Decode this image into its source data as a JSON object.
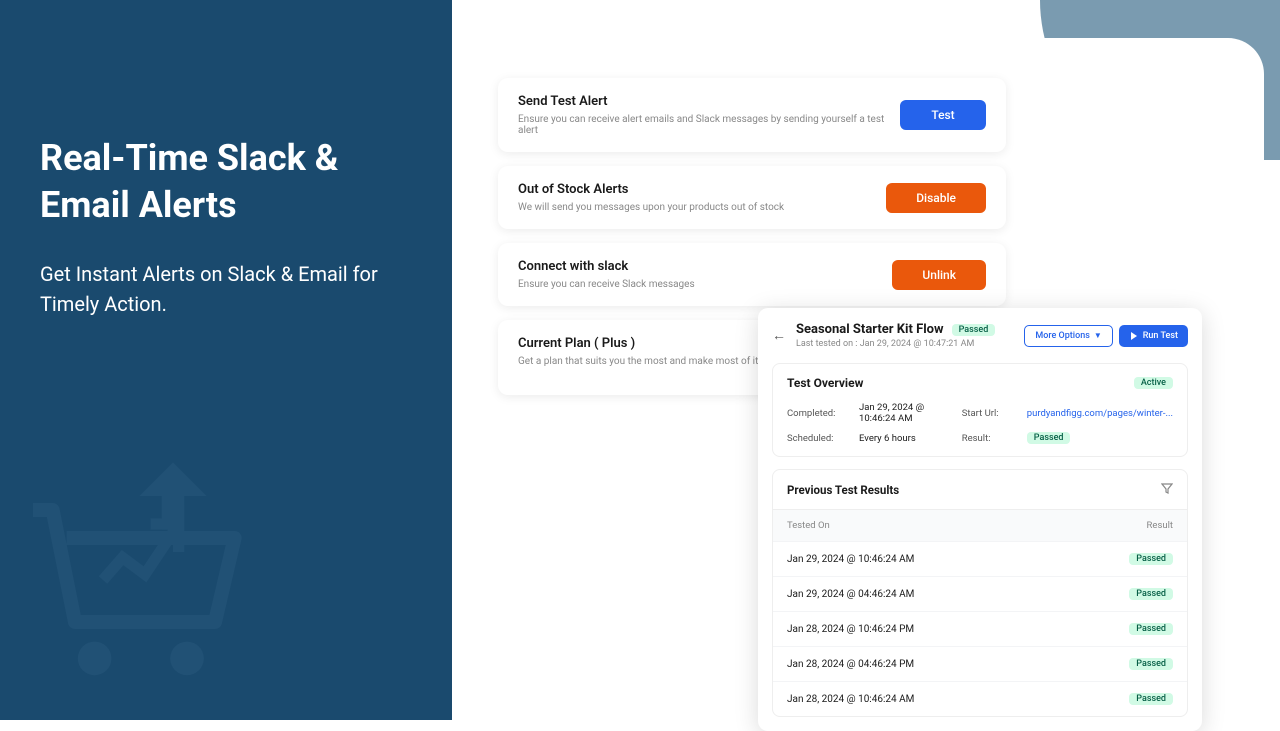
{
  "hero": {
    "title": "Real-Time Slack & Email Alerts",
    "subtitle": "Get Instant Alerts on Slack & Email for Timely Action."
  },
  "settings": [
    {
      "title": "Send Test Alert",
      "desc": "Ensure you can receive alert emails and Slack messages by sending yourself a test alert",
      "button": "Test",
      "btnClass": "btn-blue"
    },
    {
      "title": "Out of Stock Alerts",
      "desc": "We will send you messages upon your products out of stock",
      "button": "Disable",
      "btnClass": "btn-orange"
    },
    {
      "title": "Connect with slack",
      "desc": "Ensure you can receive Slack messages",
      "button": "Unlink",
      "btnClass": "btn-orange"
    },
    {
      "title": "Current Plan ( Plus )",
      "desc": "Get a plan that suits you the most and make most of it",
      "button": "",
      "btnClass": ""
    }
  ],
  "flow": {
    "title": "Seasonal Starter Kit Flow",
    "titleBadge": "Passed",
    "lastTested": "Last tested on : Jan 29, 2024 @ 10:47:21 AM",
    "moreOptions": "More Options",
    "runTest": "Run Test",
    "overview": {
      "title": "Test Overview",
      "statusBadge": "Active",
      "completed": {
        "label": "Completed:",
        "value": "Jan 29, 2024 @ 10:46:24 AM"
      },
      "scheduled": {
        "label": "Scheduled:",
        "value": "Every 6 hours"
      },
      "startUrl": {
        "label": "Start Url:",
        "value": "purdyandfigg.com/pages/winter-..."
      },
      "result": {
        "label": "Result:",
        "value": "Passed"
      }
    },
    "results": {
      "title": "Previous Test Results",
      "colTested": "Tested On",
      "colResult": "Result",
      "rows": [
        {
          "date": "Jan 29, 2024 @ 10:46:24 AM",
          "result": "Passed"
        },
        {
          "date": "Jan 29, 2024 @ 04:46:24 AM",
          "result": "Passed"
        },
        {
          "date": "Jan 28, 2024 @ 10:46:24 PM",
          "result": "Passed"
        },
        {
          "date": "Jan 28, 2024 @ 04:46:24 PM",
          "result": "Passed"
        },
        {
          "date": "Jan 28, 2024 @ 10:46:24 AM",
          "result": "Passed"
        }
      ]
    }
  }
}
